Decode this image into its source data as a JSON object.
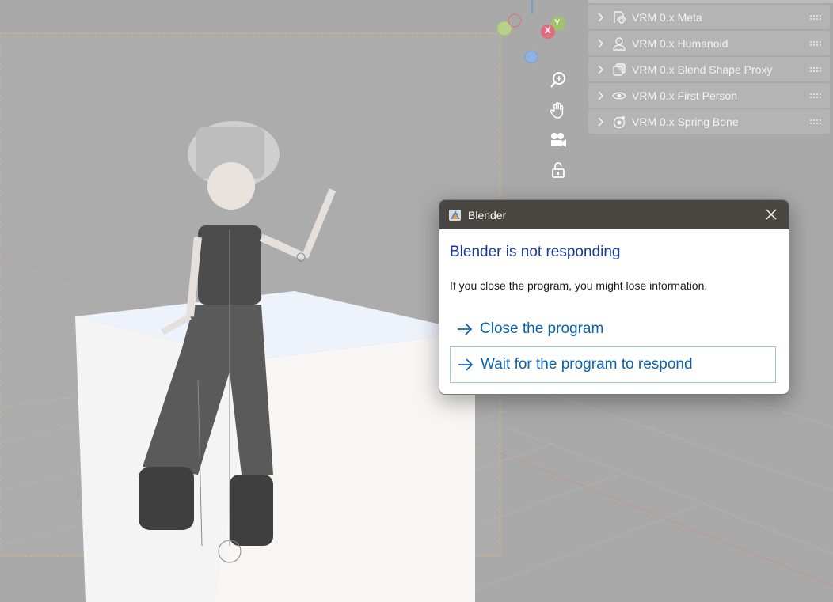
{
  "panel": {
    "items": [
      {
        "label": "VRM 0.x Meta",
        "icon": "meta-icon"
      },
      {
        "label": "VRM 0.x Humanoid",
        "icon": "humanoid-icon"
      },
      {
        "label": "VRM 0.x Blend Shape Proxy",
        "icon": "blend-shape-icon"
      },
      {
        "label": "VRM 0.x First Person",
        "icon": "eye-icon"
      },
      {
        "label": "VRM 0.x Spring Bone",
        "icon": "spring-bone-icon"
      }
    ]
  },
  "gizmo": {
    "x_label": "X",
    "y_label": "Y",
    "colors": {
      "x": "#e06c7d",
      "y": "#9fc46a",
      "z": "#6f9fdc"
    }
  },
  "tools": [
    "zoom-icon",
    "hand-icon",
    "camera-icon",
    "lock-icon"
  ],
  "dialog": {
    "app_title": "Blender",
    "heading": "Blender is not responding",
    "message": "If you close the program, you might lose information.",
    "options": [
      {
        "label": "Close the program"
      },
      {
        "label": "Wait for the program to respond"
      }
    ]
  }
}
